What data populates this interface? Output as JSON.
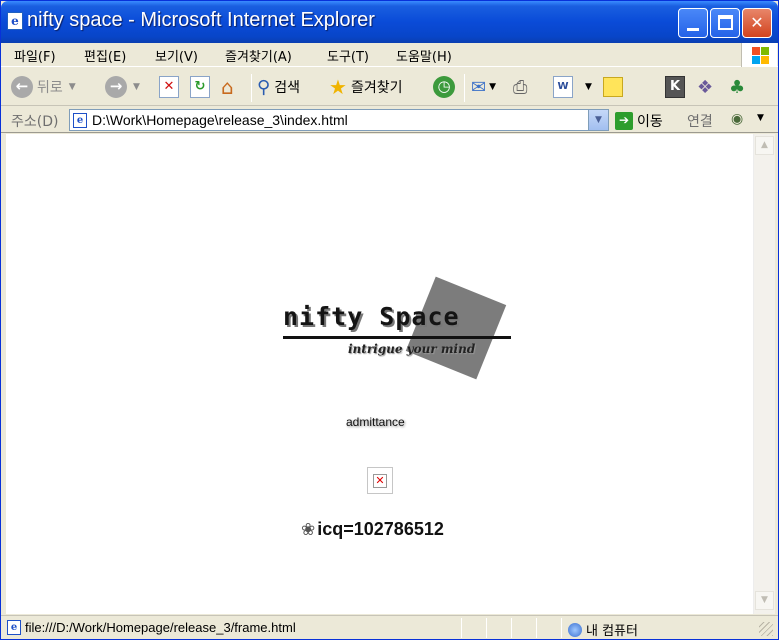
{
  "window": {
    "title": "nifty space - Microsoft Internet Explorer",
    "controls": {
      "minimize": "",
      "maximize": "",
      "close": "✕"
    }
  },
  "menu": {
    "items": [
      "파일(F)",
      "편집(E)",
      "보기(V)",
      "즐겨찾기(A)",
      "도구(T)",
      "도움말(H)"
    ]
  },
  "toolbar": {
    "back_label": "뒤로",
    "search_label": "검색",
    "favorites_label": "즐겨찾기"
  },
  "address": {
    "label": "주소(D)",
    "value": "D:\\Work\\Homepage\\release_3\\index.html",
    "go_label": "이동",
    "links_label": "연결"
  },
  "page": {
    "logo_text": "nifty Space",
    "logo_tagline": "intrigue your mind",
    "admittance_link": "admittance",
    "icq_text": "icq=102786512"
  },
  "status": {
    "text": "file:///D:/Work/Homepage/release_3/frame.html",
    "zone": "내 컴퓨터"
  },
  "colors": {
    "titlebar": "#0a4bd8",
    "chrome": "#ece9d8",
    "logo_square": "#7c7c7c"
  }
}
